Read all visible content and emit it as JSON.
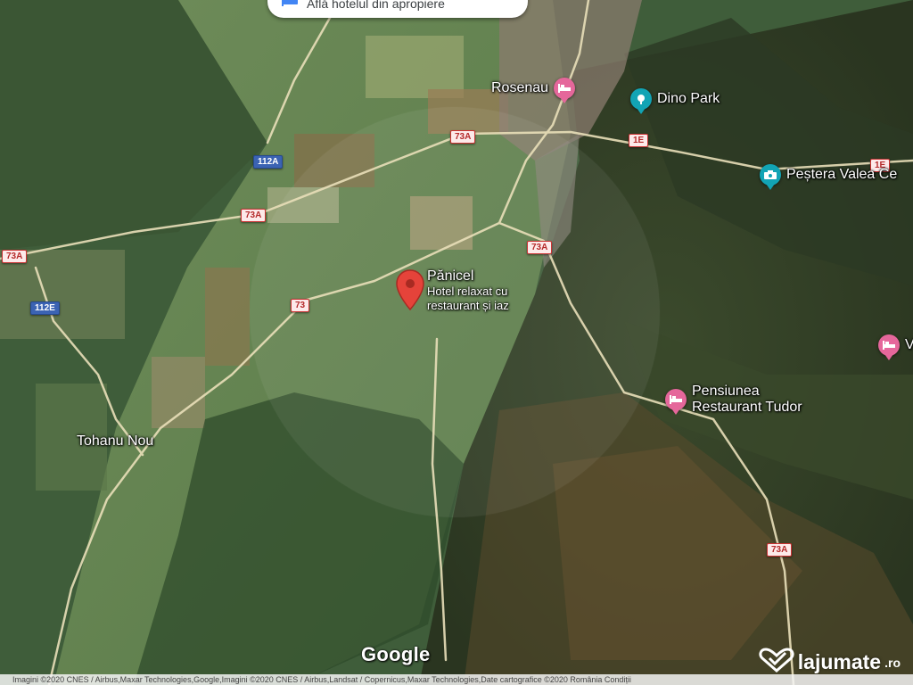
{
  "search_chip": {
    "text": "Află hotelul din apropiere",
    "icon": "bed-icon"
  },
  "places": {
    "rosenau": "Rosenau",
    "dino_park": "Dino Park",
    "pestera": "Peștera Valea Ce",
    "panicel_title": "Pănicel",
    "panicel_line1": "Hotel relaxat cu",
    "panicel_line2": "restaurant și iaz",
    "pensiunea_line1": "Pensiunea",
    "pensiunea_line2": "Restaurant Tudor",
    "tohanu_nou": "Tohanu Nou",
    "partial_v": "V"
  },
  "roads": {
    "r73a_1": "73A",
    "r73a_2": "73A",
    "r73a_3": "73A",
    "r73a_4": "73A",
    "r73a_5": "73A",
    "r73": "73",
    "r1e": "1E",
    "r1e_2": "1E",
    "r112a": "112A",
    "r112e": "112E"
  },
  "google_logo": "Google",
  "attribution": "Imagini ©2020 CNES / Airbus,Maxar Technologies,Google,Imagini ©2020 CNES / Airbus,Landsat / Copernicus,Maxar Technologies,Date cartografice ©2020    România    Condiții",
  "brand": {
    "name": "lajumate",
    "suffix": ".ro",
    "icon": "heart-check-icon"
  },
  "colors": {
    "poi_pink": "#e5679b",
    "poi_teal": "#12a4b5",
    "target_pin": "#e5433a"
  }
}
